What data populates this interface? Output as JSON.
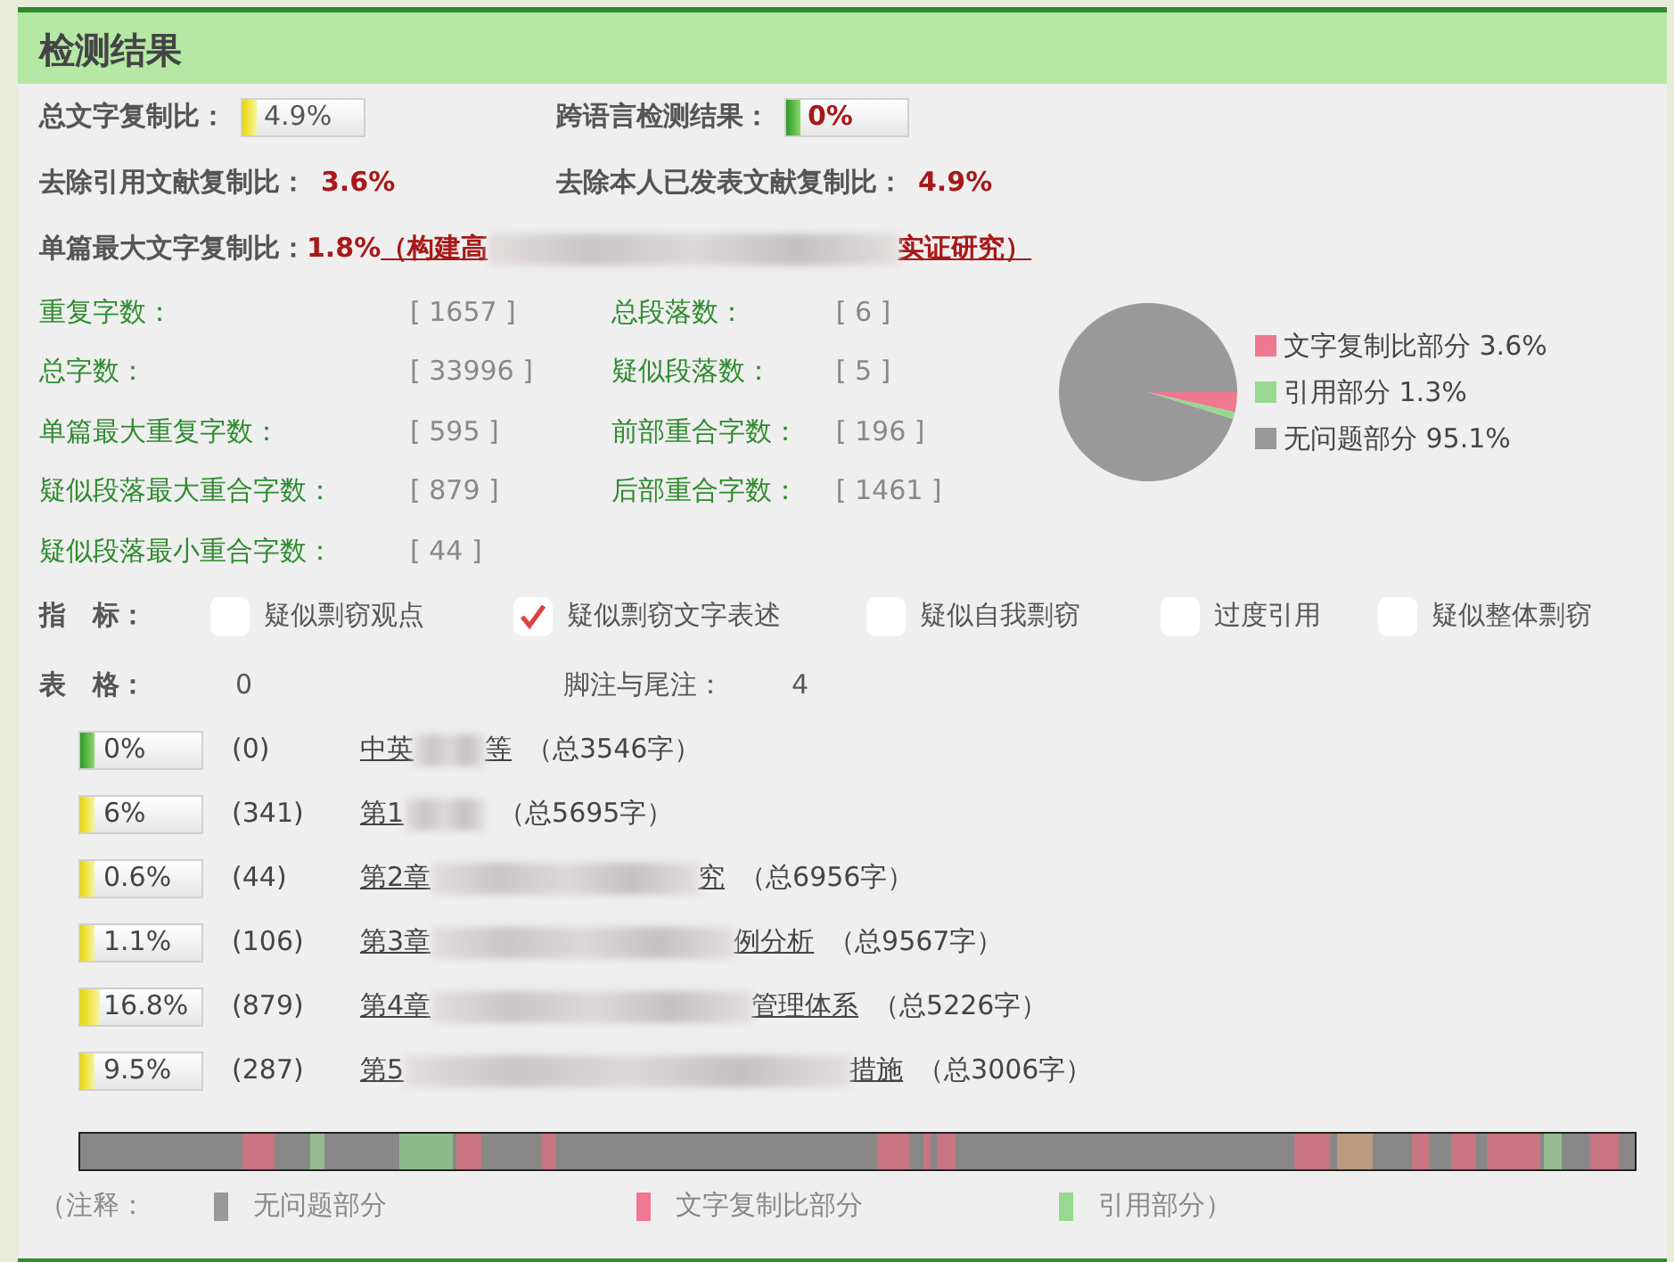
{
  "panel": {
    "title": "检测结果"
  },
  "summary": [
    {
      "label": "总文字复制比：",
      "kind": "bar",
      "value": "4.9%",
      "level": 0.049
    },
    {
      "label": "跨语言检测结果：",
      "kind": "bar",
      "value": "0%",
      "level": 0
    },
    {
      "label": "去除引用文献复制比：",
      "kind": "text",
      "value": "3.6%"
    },
    {
      "label": "去除本人已发表文献复制比：",
      "kind": "text",
      "value": "4.9%"
    }
  ],
  "max_single": {
    "label": "单篇最大文字复制比：",
    "value": "1.8%",
    "title_start": "（构建高",
    "title_end": "实证研究）"
  },
  "stats": [
    {
      "label": "重复字数：",
      "value": "[ 1657 ]"
    },
    {
      "label": "总段落数：",
      "value": "[ 6 ]"
    },
    {
      "label": "总字数：",
      "value": "[ 33996 ]"
    },
    {
      "label": "疑似段落数：",
      "value": "[ 5 ]"
    },
    {
      "label": "单篇最大重复字数：",
      "value": "[ 595 ]"
    },
    {
      "label": "前部重合字数：",
      "value": "[ 196 ]"
    },
    {
      "label": "疑似段落最大重合字数：",
      "value": "[ 879 ]"
    },
    {
      "label": "后部重合字数：",
      "value": "[ 1461 ]"
    },
    {
      "label": "疑似段落最小重合字数：",
      "value": "[ 44 ]"
    }
  ],
  "chart_data": {
    "type": "pie",
    "categories": [
      "文字复制比部分",
      "引用部分",
      "无问题部分"
    ],
    "values": [
      3.6,
      1.3,
      95.1
    ],
    "value_labels": [
      "3.6%",
      "1.3%",
      "95.1%"
    ],
    "colors": [
      "#f07890",
      "#98d890",
      "#999999"
    ],
    "legend": true
  },
  "indicators": {
    "label": "指　标：",
    "items": [
      {
        "label": "疑似剽窃观点",
        "checked": false
      },
      {
        "label": "疑似剽窃文字表述",
        "checked": true
      },
      {
        "label": "疑似自我剽窃",
        "checked": false
      },
      {
        "label": "过度引用",
        "checked": false
      },
      {
        "label": "疑似整体剽窃",
        "checked": false
      }
    ]
  },
  "tables": {
    "label": "表　格：",
    "value": "0",
    "footnote_label": "脚注与尾注：",
    "footnote_value": "4"
  },
  "sections": [
    {
      "percent": "0%",
      "level": 0,
      "count": "(0)",
      "title_start": "中英",
      "title_end": "等",
      "total": "（总3546字）"
    },
    {
      "percent": "6%",
      "level": 0.06,
      "count": "(341)",
      "title_start": "第1",
      "total": "（总5695字）"
    },
    {
      "percent": "0.6%",
      "level": 0.006,
      "count": "(44)",
      "title_start": "第2章",
      "title_end": "究",
      "total": "（总6956字）"
    },
    {
      "percent": "1.1%",
      "level": 0.011,
      "count": "(106)",
      "title_start": "第3章",
      "title_end": "例分析",
      "total": "（总9567字）"
    },
    {
      "percent": "16.8%",
      "level": 0.168,
      "count": "(879)",
      "title_start": "第4章",
      "title_end": "管理体系",
      "total": "（总5226字）"
    },
    {
      "percent": "9.5%",
      "level": 0.095,
      "count": "(287)",
      "title_start": "第5",
      "title_end": "措施",
      "total": "（总3006字）"
    }
  ],
  "legend_note": {
    "open": "（注释：",
    "items": [
      {
        "label": "无问题部分",
        "color": "#999999"
      },
      {
        "label": "文字复制比部分",
        "color": "#f07890"
      },
      {
        "label": "引用部分）",
        "color": "#98d890"
      }
    ]
  }
}
